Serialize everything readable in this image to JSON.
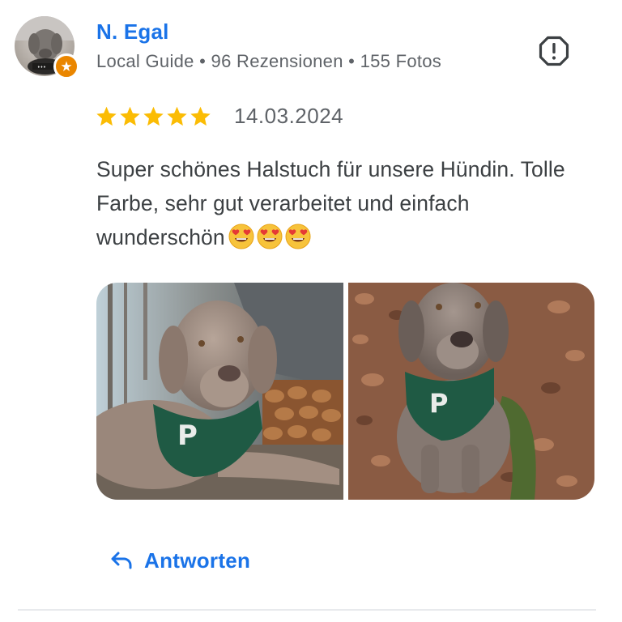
{
  "reviewer": {
    "name": "N. Egal",
    "meta": "Local Guide • 96 Rezensionen • 155 Fotos",
    "avatar_icon": "avatar-dog-photo",
    "badge_icon": "local-guide-star-icon",
    "badge_color": "#ea8600"
  },
  "review": {
    "rating": 5,
    "max_rating": 5,
    "date": "14.03.2024",
    "text": "Super schönes Halstuch für unsere Hündin. Tolle Farbe, sehr gut verarbeitet und einfach wunderschön",
    "emojis": [
      "smiling-face-with-heart-eyes",
      "smiling-face-with-heart-eyes",
      "smiling-face-with-heart-eyes"
    ],
    "star_color": "#fbbc04"
  },
  "photos": [
    {
      "description_icon": "dog-lying-with-green-bandana-photo"
    },
    {
      "description_icon": "dog-sitting-in-leaves-photo"
    }
  ],
  "actions": {
    "reply_label": "Antworten",
    "reply_icon": "reply-arrow-icon",
    "report_icon": "report-flag-icon"
  },
  "colors": {
    "link_blue": "#1a73e8",
    "text_primary": "#3c4043",
    "text_secondary": "#5f6368"
  }
}
